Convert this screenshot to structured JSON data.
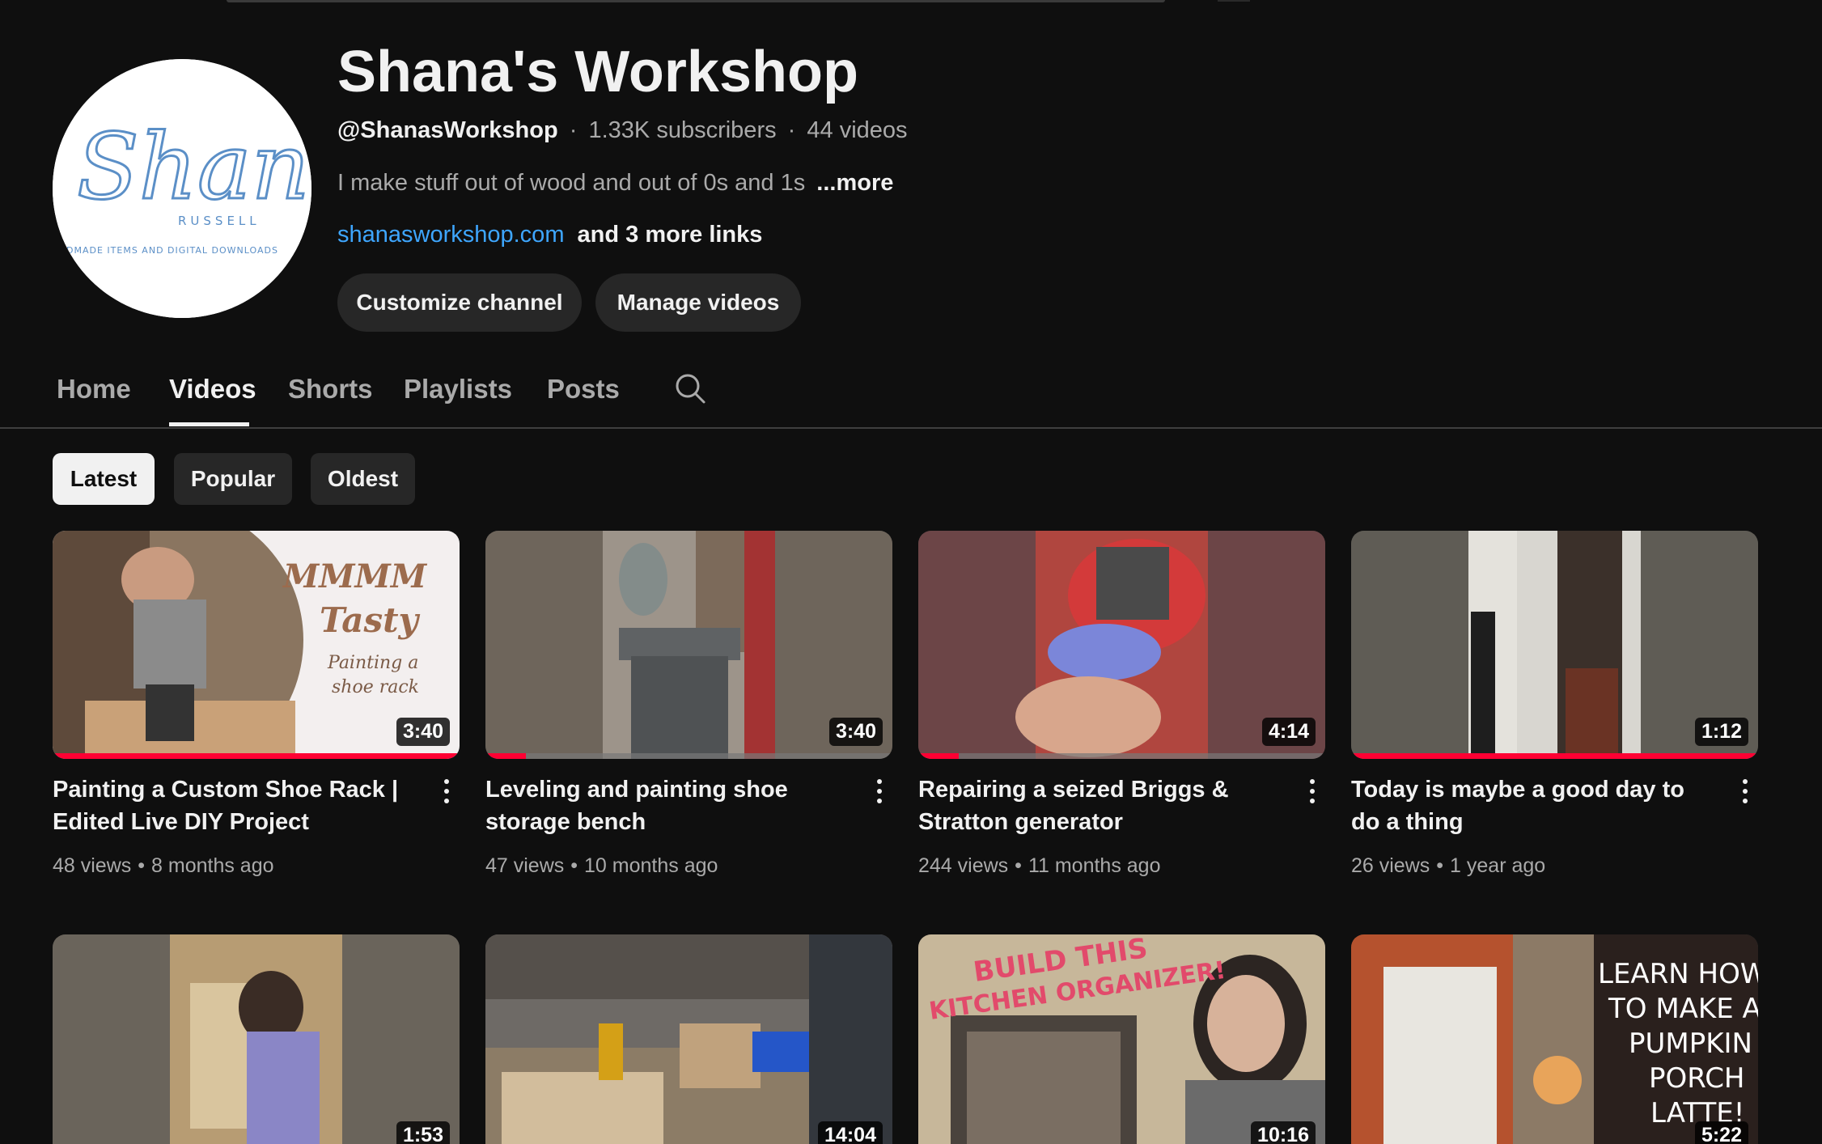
{
  "channel": {
    "name": "Shana's Workshop",
    "handle": "@ShanasWorkshop",
    "subscribers": "1.33K subscribers",
    "videos": "44 videos",
    "separator": "·",
    "description": "I make stuff out of wood and out of 0s and 1s",
    "more_label": "...more",
    "link": "shanasworkshop.com",
    "more_links": "and 3 more links",
    "avatar": {
      "script_text": "Shana",
      "sub_text": "RUSSELL",
      "tagline": "HANDMADE ITEMS AND DIGITAL DOWNLOADS"
    }
  },
  "buttons": {
    "customize": "Customize channel",
    "manage": "Manage videos"
  },
  "tabs": [
    {
      "label": "Home"
    },
    {
      "label": "Videos"
    },
    {
      "label": "Shorts"
    },
    {
      "label": "Playlists"
    },
    {
      "label": "Posts"
    }
  ],
  "active_tab": "Videos",
  "chips": [
    {
      "label": "Latest"
    },
    {
      "label": "Popular"
    },
    {
      "label": "Oldest"
    }
  ],
  "selected_chip": "Latest",
  "videos": [
    {
      "title": "Painting a Custom Shoe Rack | Edited Live DIY Project",
      "views": "48 views",
      "age": "8 months ago",
      "duration": "3:40",
      "progress": 1.0,
      "thumb_text": [
        "MMMM",
        "Tasty",
        "Painting a",
        "shoe rack"
      ]
    },
    {
      "title": "Leveling and painting shoe storage bench",
      "views": "47 views",
      "age": "10 months ago",
      "duration": "3:40",
      "progress": 0.1
    },
    {
      "title": "Repairing a seized Briggs & Stratton generator",
      "views": "244 views",
      "age": "11 months ago",
      "duration": "4:14",
      "progress": 0.1
    },
    {
      "title": "Today is maybe a good day to do a thing",
      "views": "26 views",
      "age": "1 year ago",
      "duration": "1:12",
      "progress": 1.0
    },
    {
      "duration": "1:53"
    },
    {
      "duration": "14:04"
    },
    {
      "duration": "10:16",
      "thumb_text": [
        "BUILD THIS",
        "KITCHEN ORGANIZER!"
      ]
    },
    {
      "duration": "5:22",
      "thumb_text": [
        "LEARN HOW",
        "TO MAKE A",
        "PUMPKIN",
        "PORCH",
        "LATTE!"
      ]
    }
  ],
  "colors": {
    "background": "#0f0f0f",
    "link": "#3ea6ff",
    "progress": "#ff0033",
    "chip_bg": "#272727"
  }
}
